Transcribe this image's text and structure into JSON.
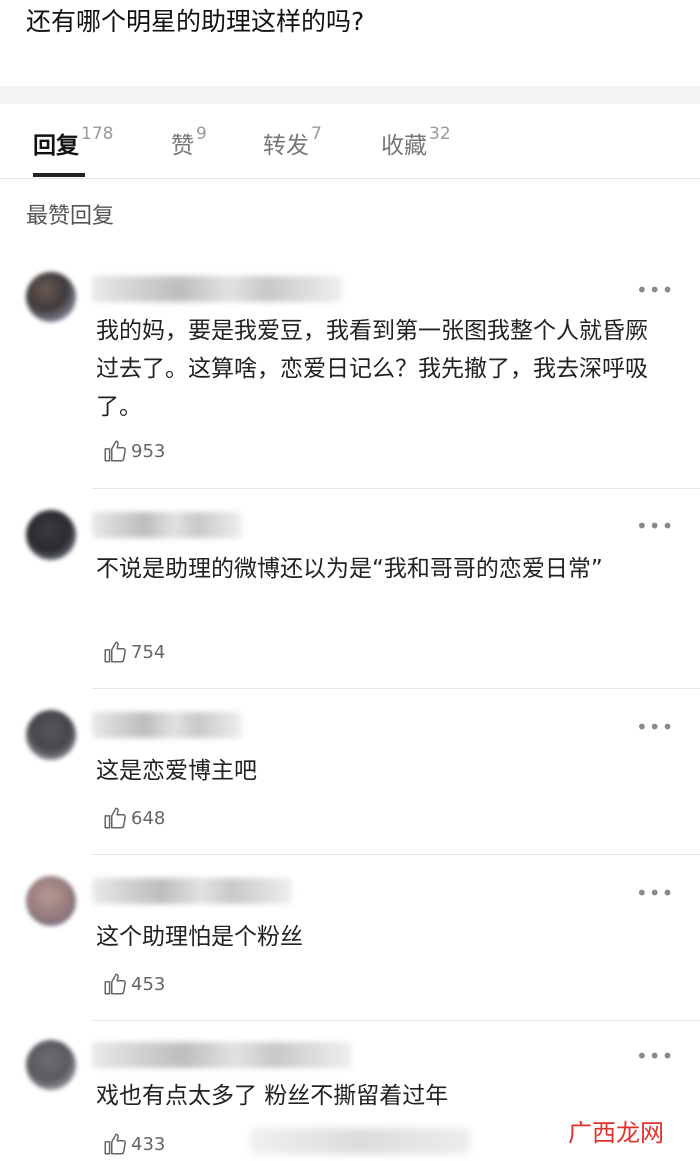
{
  "post": {
    "title": "还有哪个明星的助理这样的吗?"
  },
  "tabs": [
    {
      "label": "回复",
      "count": "178"
    },
    {
      "label": "赞",
      "count": "9"
    },
    {
      "label": "转发",
      "count": "7"
    },
    {
      "label": "收藏",
      "count": "32"
    }
  ],
  "section_label": "最赞回复",
  "comments": [
    {
      "text": "我的妈，要是我爱豆，我看到第一张图我整个人就昏厥过去了。这算啥，恋爱日记么？我先撤了，我去深呼吸了。",
      "likes": "953",
      "more": "•••"
    },
    {
      "text": "不说是助理的微博还以为是“我和哥哥的恋爱日常”",
      "likes": "754",
      "more": "•••"
    },
    {
      "text": "这是恋爱博主吧",
      "likes": "648",
      "more": "•••"
    },
    {
      "text": "这个助理怕是个粉丝",
      "likes": "453",
      "more": "•••"
    },
    {
      "text": "戏也有点太多了 粉丝不撕留着过年",
      "likes": "433",
      "more": "•••"
    }
  ],
  "watermark": {
    "part1": "广",
    "part2": "西",
    "part3": "龙网"
  },
  "colors": {
    "accent": "#222222",
    "watermark": "#e2312b"
  }
}
